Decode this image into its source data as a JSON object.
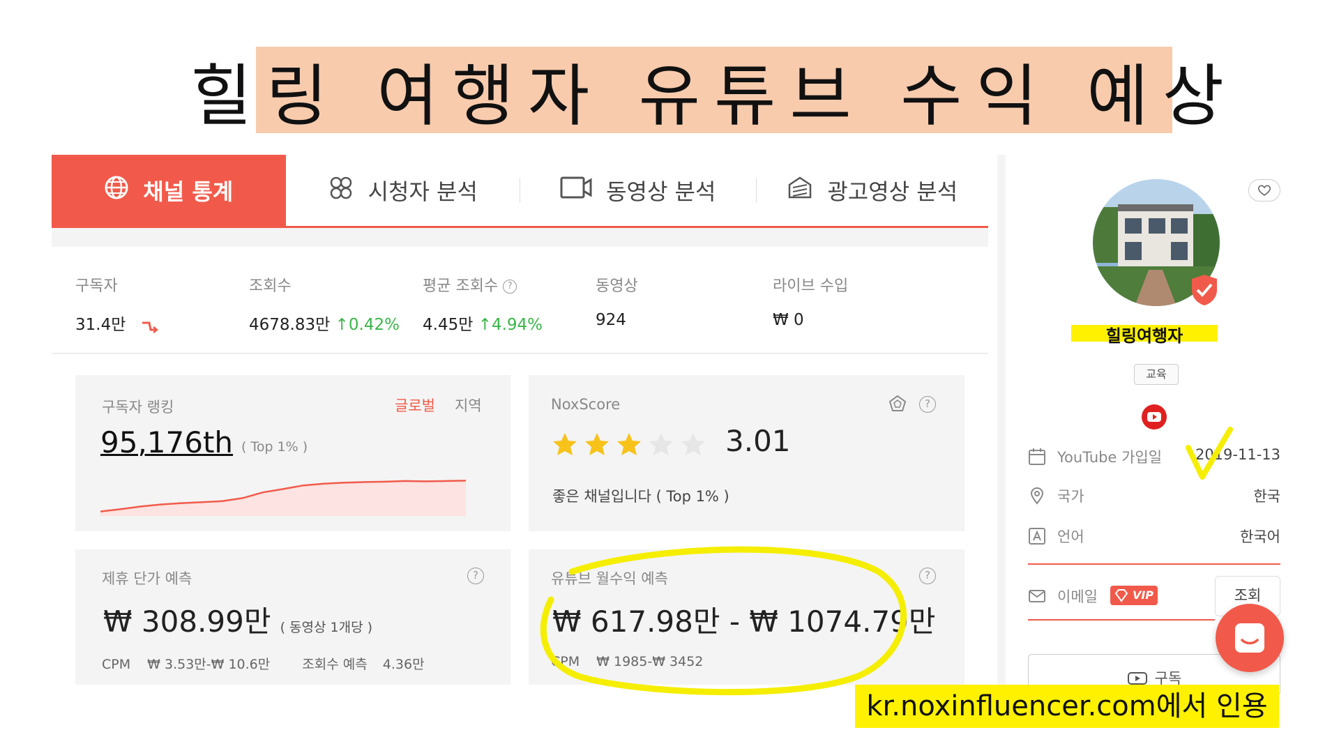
{
  "title": "힐링 여행자 유튜브 수익 예상",
  "tabs": [
    {
      "label": "채널 통계",
      "icon": "globe-icon"
    },
    {
      "label": "시청자 분석",
      "icon": "audience-icon"
    },
    {
      "label": "동영상 분석",
      "icon": "video-icon"
    },
    {
      "label": "광고영상 분석",
      "icon": "ad-icon"
    }
  ],
  "stats": {
    "subscribers": {
      "label": "구독자",
      "value": "31.4만",
      "trend": "down"
    },
    "views": {
      "label": "조회수",
      "value": "4678.83만",
      "change": "0.42%"
    },
    "avg_views": {
      "label": "평균 조회수",
      "value": "4.45만",
      "change": "4.94%"
    },
    "videos": {
      "label": "동영상",
      "value": "924"
    },
    "live_income": {
      "label": "라이브 수입",
      "value": "₩ 0"
    }
  },
  "rank_card": {
    "label": "구독자 랭킹",
    "global": "글로벌",
    "region": "지역",
    "rank": "95,176th",
    "top": "( Top 1% )",
    "trend_values": [
      0.05,
      0.12,
      0.2,
      0.26,
      0.3,
      0.33,
      0.36,
      0.45,
      0.62,
      0.72,
      0.83,
      0.88,
      0.91,
      0.93,
      0.94,
      0.96,
      0.95,
      0.96,
      0.97
    ]
  },
  "nox_card": {
    "label": "NoxScore",
    "score": "3.01",
    "stars_filled": 3,
    "stars_total": 5,
    "desc": "좋은 채널입니다 ( Top 1% )"
  },
  "partner_card": {
    "label": "제휴 단가 예측",
    "value": "₩ 308.99만",
    "unit": "( 동영상 1개당 )",
    "cpm_label": "CPM",
    "cpm_value": "₩ 3.53만-₩ 10.6만",
    "views_label": "조회수 예측",
    "views_value": "4.36만"
  },
  "revenue_card": {
    "label": "유튜브 월수익 예측",
    "value": "₩ 617.98만 - ₩ 1074.79만",
    "cpm_label": "CPM",
    "cpm_value": "₩ 1985-₩ 3452"
  },
  "profile": {
    "channel_name": "힐링여행자",
    "tag": "교육",
    "joined_label": "YouTube 가입일",
    "joined_value": "2019-11-13",
    "country_label": "국가",
    "country_value": "한국",
    "language_label": "언어",
    "language_value": "한국어",
    "email_label": "이메일",
    "vip": "VIP",
    "lookup": "조회",
    "subscribe": "구독"
  },
  "source": "kr.noxinfluencer.com에서 인용",
  "colors": {
    "accent": "#f15a4a",
    "up": "#3bb54a",
    "highlight": "#fff100",
    "banner": "#f8cbad",
    "star": "#f7c31b"
  }
}
